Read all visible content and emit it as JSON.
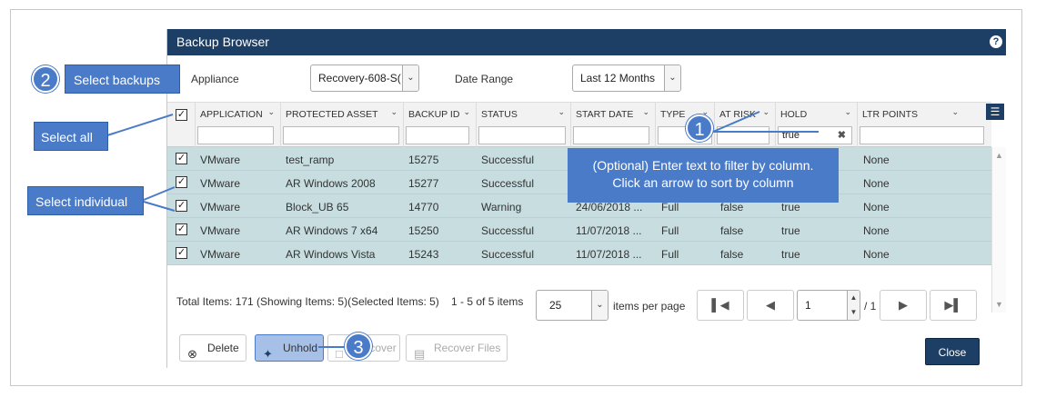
{
  "window": {
    "title": "Backup Browser",
    "help_icon": "?"
  },
  "appliance": {
    "label": "Appliance",
    "value": "Recovery-608-S("
  },
  "date_range": {
    "label": "Date Range",
    "value": "Last 12 Months"
  },
  "columns": [
    {
      "label": "APPLICATION",
      "filter": ""
    },
    {
      "label": "PROTECTED ASSET",
      "filter": ""
    },
    {
      "label": "BACKUP ID",
      "filter": ""
    },
    {
      "label": "STATUS",
      "filter": ""
    },
    {
      "label": "START DATE",
      "filter": ""
    },
    {
      "label": "TYPE",
      "filter": ""
    },
    {
      "label": "AT RISK",
      "filter": ""
    },
    {
      "label": "HOLD",
      "filter": "true"
    },
    {
      "label": "LTR POINTS",
      "filter": ""
    }
  ],
  "rows": [
    {
      "application": "VMware",
      "asset": "test_ramp",
      "backup_id": "15275",
      "status": "Successful",
      "start_date": "",
      "type": "",
      "at_risk": "",
      "hold": "",
      "ltr": "None"
    },
    {
      "application": "VMware",
      "asset": "AR Windows 2008",
      "backup_id": "15277",
      "status": "Successful",
      "start_date": "",
      "type": "",
      "at_risk": "",
      "hold": "",
      "ltr": "None"
    },
    {
      "application": "VMware",
      "asset": "Block_UB 65",
      "backup_id": "14770",
      "status": "Warning",
      "start_date": "24/06/2018 ...",
      "type": "Full",
      "at_risk": "false",
      "hold": "true",
      "ltr": "None"
    },
    {
      "application": "VMware",
      "asset": "AR Windows 7 x64",
      "backup_id": "15250",
      "status": "Successful",
      "start_date": "11/07/2018 ...",
      "type": "Full",
      "at_risk": "false",
      "hold": "true",
      "ltr": "None"
    },
    {
      "application": "VMware",
      "asset": "AR Windows Vista",
      "backup_id": "15243",
      "status": "Successful",
      "start_date": "11/07/2018 ...",
      "type": "Full",
      "at_risk": "false",
      "hold": "true",
      "ltr": "None"
    }
  ],
  "footer": {
    "totals": "Total Items: 171 (Showing Items: 5)(Selected Items: 5)",
    "range": "1 - 5 of 5 items",
    "per_page_value": "25",
    "per_page_label": "items per page",
    "page_value": "1",
    "page_total": "/ 1"
  },
  "actions": {
    "delete": "Delete",
    "unhold": "Unhold",
    "recover": "Recover",
    "recover_files": "Recover Files",
    "close": "Close"
  },
  "annotations": {
    "step1": "1",
    "step2": "2",
    "step3": "3",
    "select_backups": "Select backups",
    "select_all": "Select all",
    "select_individual": "Select individual",
    "tip_line1": "(Optional) Enter text to filter by column.",
    "tip_line2": "Click an arrow to sort by column"
  },
  "colors": {
    "title_bar": "#1d3f66",
    "selected_row": "#c7dde0",
    "callout": "#4a7bc8"
  }
}
